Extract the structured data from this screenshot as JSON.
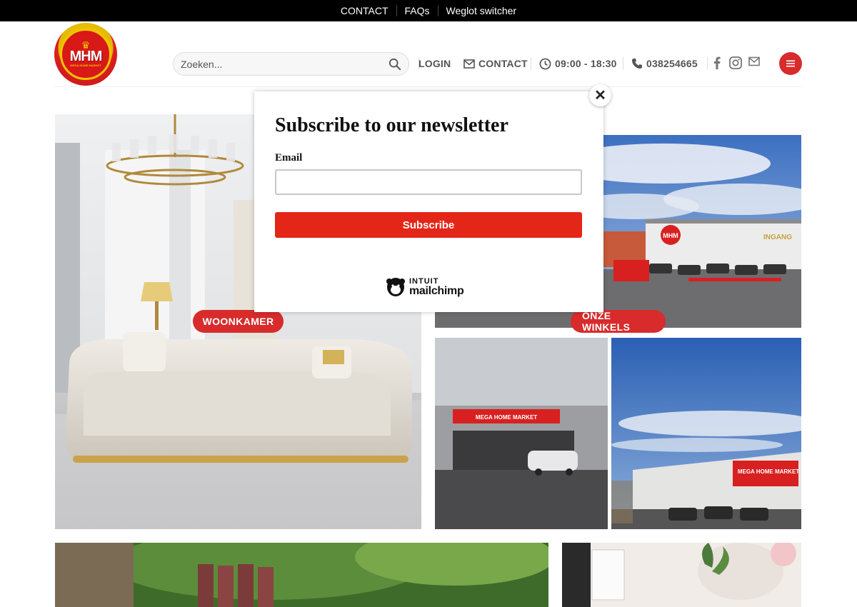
{
  "topbar": {
    "links": [
      "CONTACT",
      "FAQs",
      "Weglot switcher"
    ]
  },
  "logo": {
    "mark": "MHM",
    "tagline": "MEGA HOME MARKET"
  },
  "search": {
    "placeholder": "Zoeken..."
  },
  "nav": {
    "login": "LOGIN",
    "contact": "CONTACT",
    "hours": "09:00 - 18:30",
    "phone": "038254665"
  },
  "social": {
    "icons": [
      "facebook-icon",
      "instagram-icon",
      "mail-icon"
    ]
  },
  "tiles": {
    "living": {
      "tag": "WOONKAMER"
    },
    "stores": {
      "tag": "ONZE WINKELS"
    },
    "store_sign_1": "MEGA HOME MARKET",
    "store_sign_2": "MEGA HOME MARKET",
    "store_entrance": "INGANG"
  },
  "popup": {
    "title": "Subscribe to our newsletter",
    "email_label": "Email",
    "email_value": "",
    "button": "Subscribe",
    "brand_top": "INTUIT",
    "brand_bottom": "mailchimp"
  },
  "colors": {
    "accent": "#d82b2b",
    "subscribe": "#e42618",
    "topbar": "#000000"
  }
}
